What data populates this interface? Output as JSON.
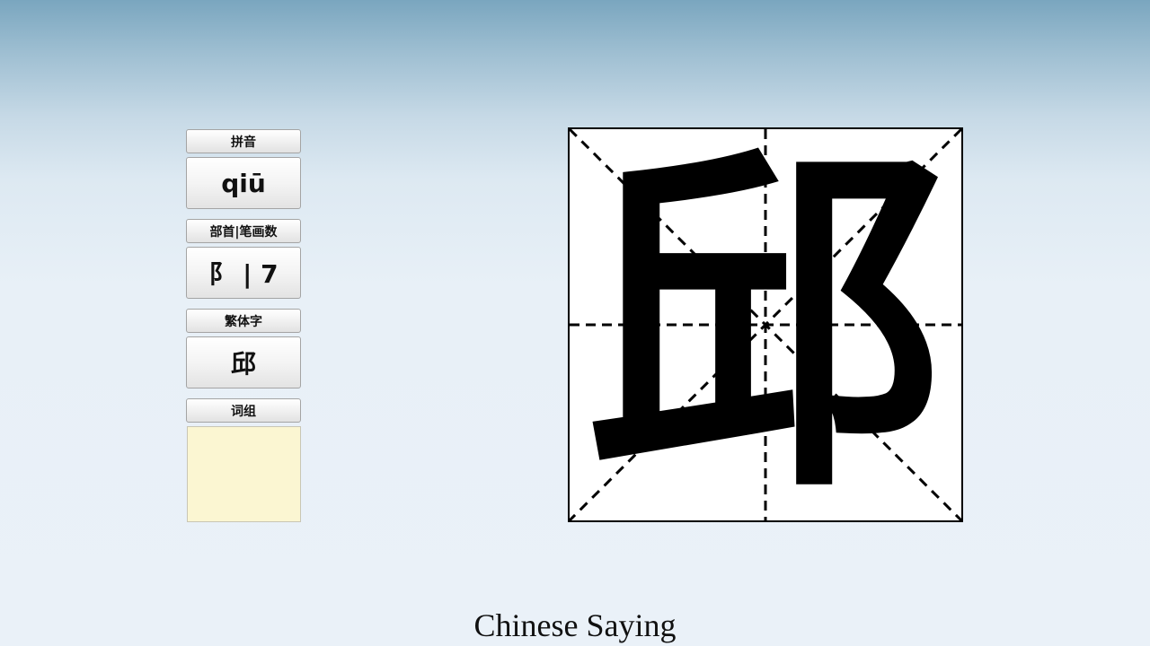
{
  "panels": {
    "pinyin": {
      "label": "拼音",
      "value": "qiū"
    },
    "radical_strokes": {
      "label": "部首|笔画数",
      "value": "阝 | 7"
    },
    "traditional": {
      "label": "繁体字",
      "value": "邱"
    },
    "words": {
      "label": "词组",
      "value": ""
    }
  },
  "character": {
    "glyph": "邱",
    "grid_style": "米字格"
  },
  "footer": {
    "title": "Chinese Saying"
  }
}
